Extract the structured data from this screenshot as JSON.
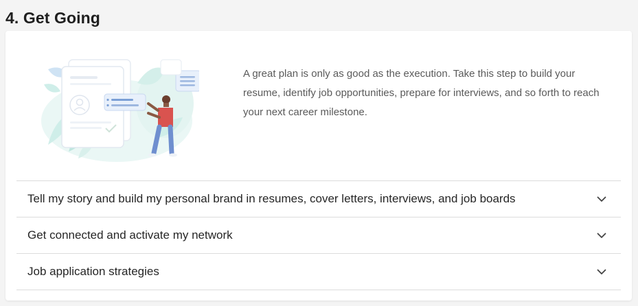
{
  "section": {
    "title": "4. Get Going"
  },
  "intro": {
    "text": "A great plan is only as good as the execution. Take this step to build your resume, identify job opportunities, prepare for interviews, and so forth to reach your next career milestone."
  },
  "accordion": {
    "items": [
      {
        "label": "Tell my story and build my personal brand in resumes, cover letters, interviews, and job boards",
        "icon": "chevron-down-icon"
      },
      {
        "label": "Get connected and activate my network",
        "icon": "chevron-down-icon"
      },
      {
        "label": "Job application strategies",
        "icon": "chevron-down-icon"
      }
    ]
  },
  "colors": {
    "background": "#f4f4f4",
    "card": "#ffffff",
    "divider": "#dcdcdc",
    "accent_blue": "#7b9fd6",
    "accent_teal": "#cfeee9",
    "person_shirt": "#d9534f"
  }
}
